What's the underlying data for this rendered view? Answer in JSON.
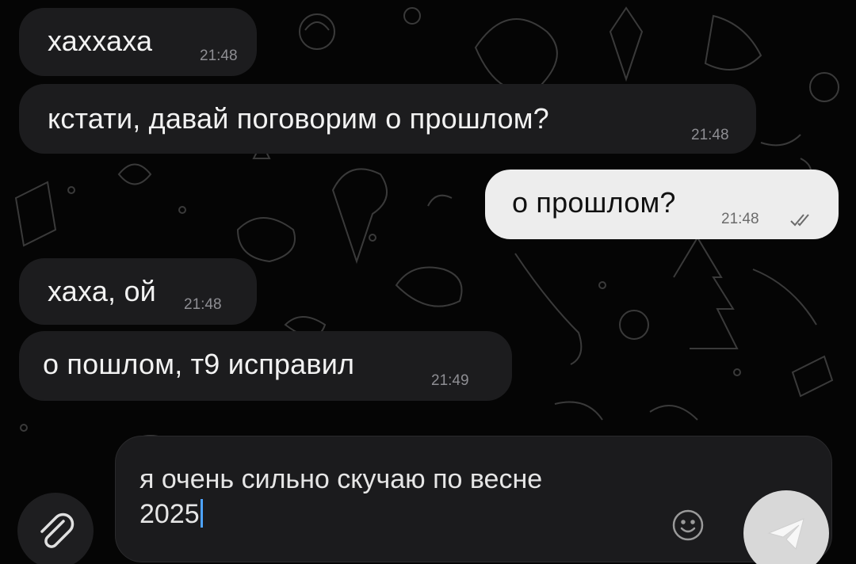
{
  "messages": [
    {
      "direction": "incoming",
      "text": "хаххаха",
      "time": "21:48"
    },
    {
      "direction": "incoming",
      "text": "кстати, давай поговорим о прошлом?",
      "time": "21:48"
    },
    {
      "direction": "outgoing",
      "text": "о прошлом?",
      "time": "21:48",
      "status_icon": "double-check-icon"
    },
    {
      "direction": "incoming",
      "text": "хаха, ой",
      "time": "21:48"
    },
    {
      "direction": "incoming",
      "text": "о пошлом, т9 исправил",
      "time": "21:49"
    }
  ],
  "composer": {
    "text": "я очень сильно скучаю по весне\n2025",
    "attach_icon": "paperclip-icon",
    "emoji_icon": "smiley-icon",
    "send_icon": "paper-plane-icon"
  },
  "colors": {
    "background": "#000000",
    "incoming_bubble": "#1c1c1e",
    "outgoing_bubble": "#ededed",
    "timestamp": "#8e8e93",
    "caret": "#4da3ff"
  }
}
